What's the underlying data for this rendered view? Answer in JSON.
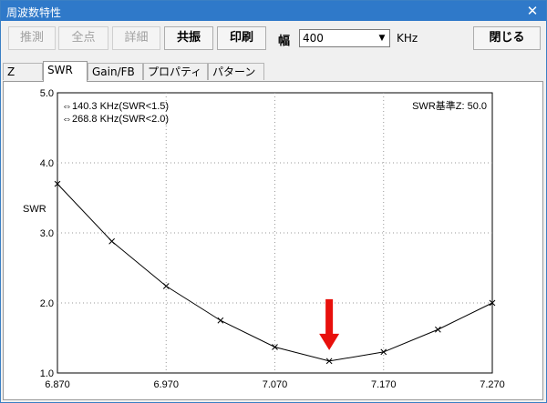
{
  "window": {
    "title": "周波数特性",
    "close_symbol": "✕"
  },
  "toolbar": {
    "estimate_label": "推測",
    "all_points_label": "全点",
    "detail_label": "詳細",
    "resonance_label": "共振",
    "print_label": "印刷",
    "width_label": "幅",
    "width_value": "400",
    "width_unit": "KHz",
    "close_label": "閉じる"
  },
  "tabs": [
    {
      "label": "Z",
      "active": false
    },
    {
      "label": "SWR",
      "active": true
    },
    {
      "label": "Gain/FB",
      "active": false
    },
    {
      "label": "プロパティ",
      "active": false
    },
    {
      "label": "パターン",
      "active": false
    }
  ],
  "annotations": {
    "bw15": "⇔140.3 KHz(SWR<1.5)",
    "bw20": "⇔268.8 KHz(SWR<2.0)",
    "reference": "SWR基準Z: 50.0"
  },
  "colors": {
    "title_bar": "#2f79c9",
    "marker_arrow": "#e8100c"
  },
  "chart_data": {
    "type": "line",
    "ylabel": "SWR",
    "xlabel": "",
    "xlim": [
      6.87,
      7.27
    ],
    "ylim": [
      1.0,
      5.0
    ],
    "x_ticks": [
      "6.870",
      "6.970",
      "7.070",
      "7.170",
      "7.270"
    ],
    "x_tick_values": [
      6.87,
      6.97,
      7.07,
      7.17,
      7.27
    ],
    "y_ticks": [
      "1.0",
      "2.0",
      "3.0",
      "4.0",
      "5.0"
    ],
    "y_tick_values": [
      1.0,
      2.0,
      3.0,
      4.0,
      5.0
    ],
    "grid": true,
    "series": [
      {
        "x": [
          6.87,
          6.92,
          6.97,
          7.02,
          7.07,
          7.12,
          7.17,
          7.22,
          7.27
        ],
        "y": [
          3.7,
          2.88,
          2.24,
          1.75,
          1.37,
          1.17,
          1.3,
          1.62,
          2.0
        ]
      }
    ],
    "marker": {
      "type": "arrow-down",
      "x": 7.12,
      "y": 1.17
    }
  }
}
